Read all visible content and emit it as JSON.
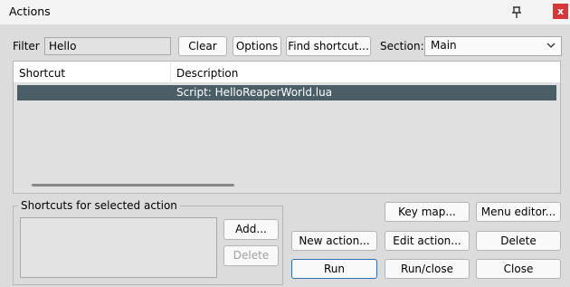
{
  "window": {
    "title": "Actions",
    "close_label": "x"
  },
  "filter": {
    "label": "Filter",
    "value": "Hello"
  },
  "toolbar": {
    "clear": "Clear",
    "options": "Options",
    "find_shortcut": "Find shortcut..."
  },
  "section": {
    "label": "Section:",
    "value": "Main"
  },
  "list": {
    "columns": [
      "Shortcut",
      "Description"
    ],
    "rows": [
      {
        "shortcut": "",
        "description": "Script: HelloReaperWorld.lua",
        "selected": true
      }
    ]
  },
  "shortcuts_group": {
    "title": "Shortcuts for selected action",
    "add": "Add...",
    "delete": "Delete"
  },
  "buttons": {
    "key_map": "Key map...",
    "menu_editor": "Menu editor...",
    "new_action": "New action...",
    "edit_action": "Edit action...",
    "delete": "Delete",
    "run": "Run",
    "run_close": "Run/close",
    "close": "Close"
  },
  "colors": {
    "selection": "#4a5e66",
    "close_button": "#d9363a",
    "primary_border": "#2f6fb5"
  }
}
